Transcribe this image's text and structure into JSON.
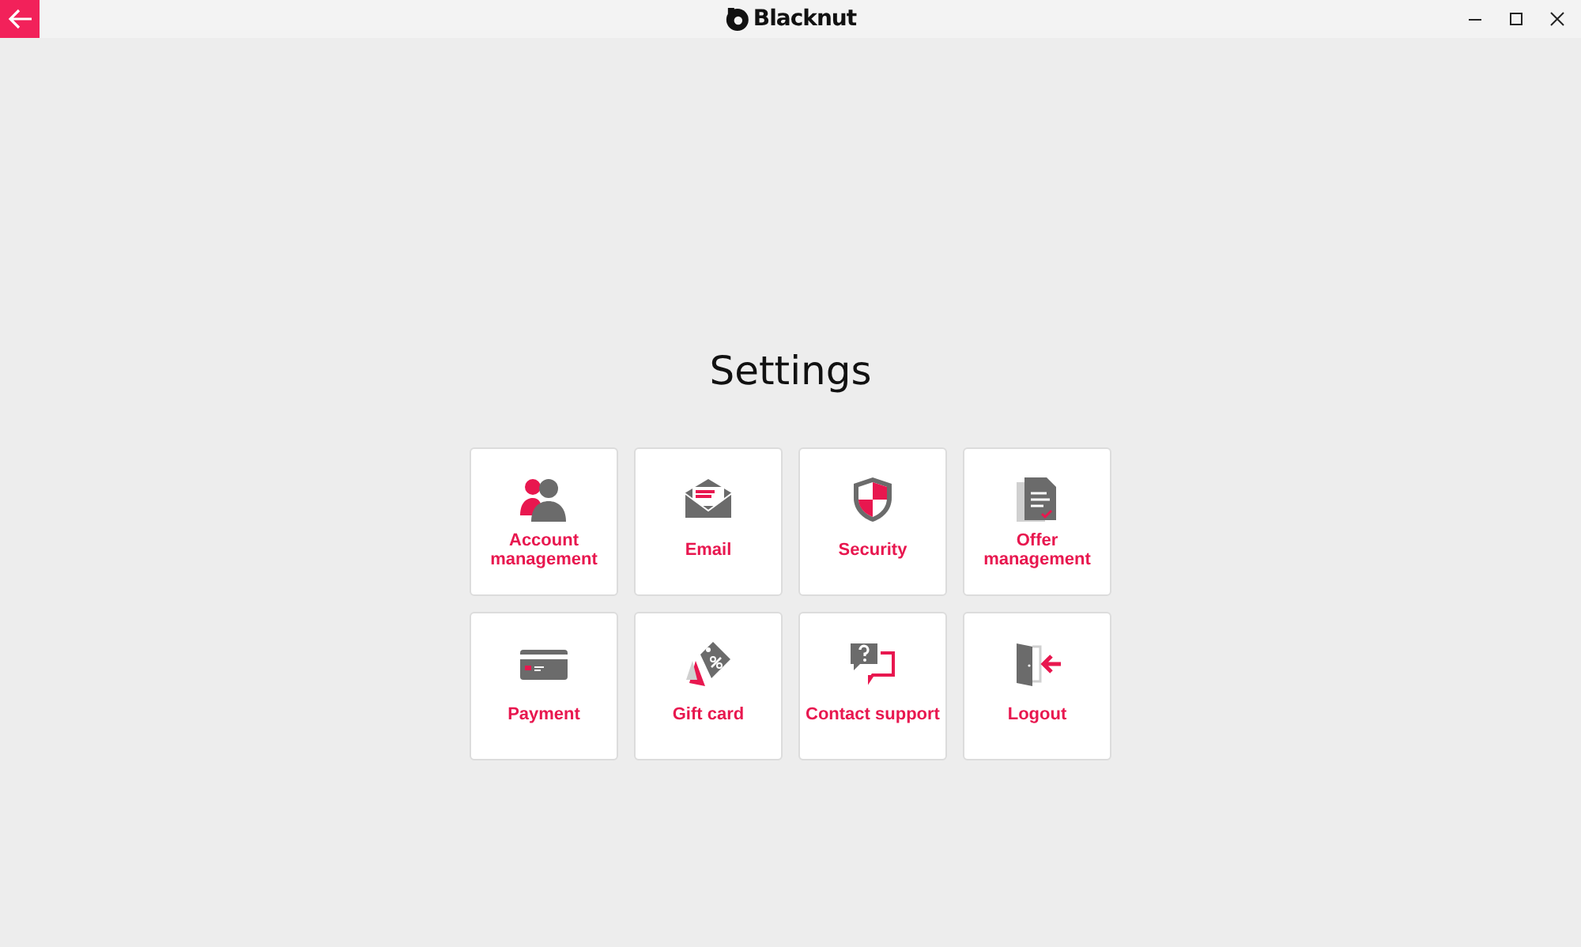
{
  "window": {
    "app_name": "Blacknut"
  },
  "page": {
    "title": "Settings"
  },
  "tiles": [
    {
      "kind": "account",
      "label": "Account management"
    },
    {
      "kind": "email",
      "label": "Email"
    },
    {
      "kind": "security",
      "label": "Security"
    },
    {
      "kind": "offer",
      "label": "Offer management"
    },
    {
      "kind": "payment",
      "label": "Payment"
    },
    {
      "kind": "gift",
      "label": "Gift card"
    },
    {
      "kind": "support",
      "label": "Contact support"
    },
    {
      "kind": "logout",
      "label": "Logout"
    }
  ]
}
